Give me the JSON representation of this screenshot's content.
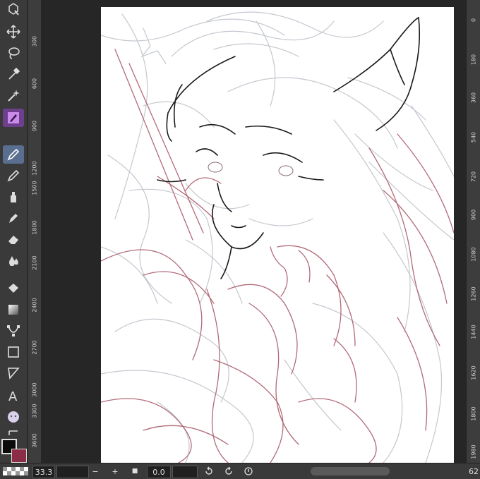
{
  "rulers": {
    "left": [
      "300",
      "600",
      "900",
      "1200",
      "1500",
      "1800",
      "2100",
      "2400",
      "2700",
      "3000",
      "3300",
      "3600"
    ],
    "right": [
      "0",
      "180",
      "360",
      "540",
      "720",
      "900",
      "1080",
      "1260",
      "1440",
      "1620",
      "1800",
      "1980"
    ]
  },
  "statusbar": {
    "zoom": "33.3",
    "minus": "−",
    "plus": "+",
    "stop": "■",
    "rotation": "0.0",
    "right_value": "62"
  },
  "colors": {
    "foreground": "#0b0b0b",
    "background": "#8b2d47",
    "sketch_pink": "#b06070",
    "sketch_gray": "#b8bcc4",
    "line_black": "#1a1a1a"
  },
  "tools": [
    "layer-move-icon",
    "move-icon",
    "lasso-icon",
    "eyedropper-icon",
    "magic-wand-icon",
    "pen-tool-icon",
    "pen-icon",
    "pencil-icon",
    "airbrush-icon",
    "marker-icon",
    "eraser-icon",
    "blend-icon",
    "fill-icon",
    "gradient-icon",
    "curve-icon",
    "rectangle-icon",
    "ruler-icon",
    "text-icon",
    "balloon-icon",
    "correction-icon"
  ]
}
